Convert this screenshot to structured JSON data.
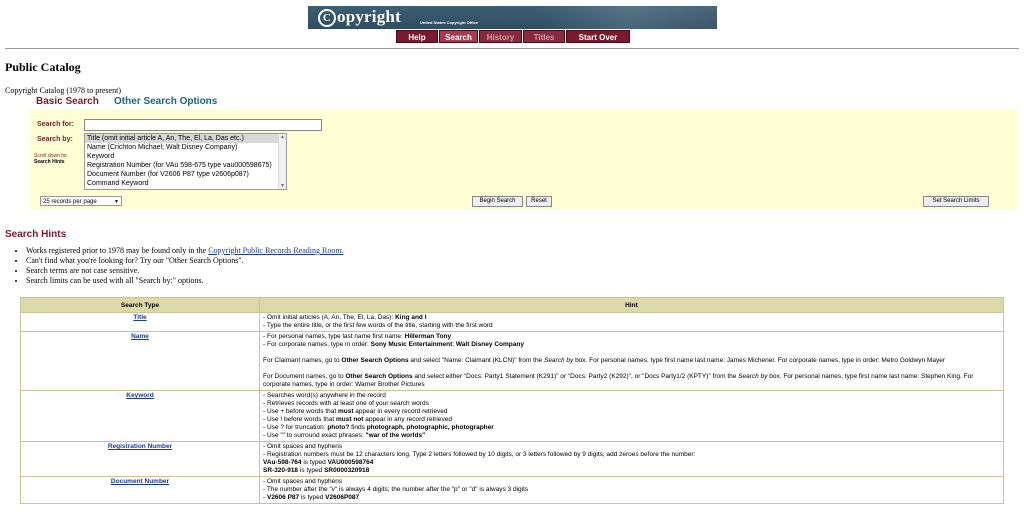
{
  "header": {
    "logo": "opyright",
    "logo_c": "C",
    "subtitle": "United States Copyright Office",
    "nav": [
      {
        "label": "Help",
        "state": "normal"
      },
      {
        "label": "Search",
        "state": "active"
      },
      {
        "label": "History",
        "state": "dim"
      },
      {
        "label": "Titles",
        "state": "dim"
      },
      {
        "label": "Start Over",
        "state": "normal"
      }
    ]
  },
  "page_title": "Public Catalog",
  "catalog_label": "Copyright Catalog (1978 to present)",
  "tabs": {
    "basic": "Basic Search",
    "other": "Other Search Options"
  },
  "search": {
    "search_for_label": "Search for:",
    "search_for_value": "",
    "search_by_label": "Search by:",
    "scroll_hint": "Scroll down for",
    "scroll_hint_bold": "Search Hints",
    "options": [
      "Title (omit initial article A, An, The, El, La, Das etc.)",
      "Name (Crichton Michael; Walt Disney Company)",
      "Keyword",
      "Registration Number (for VAu 598-675 type vau000598675)",
      "Document Number (for V2606 P87 type v2606p087)",
      "Command Keyword"
    ],
    "selected_index": 0
  },
  "controls": {
    "records_per_page": "25 records per page",
    "begin_search": "Begin Search",
    "reset": "Reset",
    "set_limits": "Set Search Limits"
  },
  "hints": {
    "heading": "Search Hints",
    "items": [
      {
        "pre": "Works registered prior to 1978 may be found only in the ",
        "link": "Copyright Public Records Reading Room.",
        "post": ""
      },
      {
        "pre": "Can't find what you're looking for? Try our \"Other Search Options\".",
        "link": "",
        "post": ""
      },
      {
        "pre": "Search terms are not case sensitive.",
        "link": "",
        "post": ""
      },
      {
        "pre": "Search limits can be used with all \"Search by:\" options.",
        "link": "",
        "post": ""
      }
    ]
  },
  "table": {
    "col_type": "Search Type",
    "col_hint": "Hint",
    "rows": [
      {
        "type": "Title",
        "lines": [
          "- Omit initial articles (A, An, The, El, La, Das): <b>King and I</b>",
          "- Type the entire title, or the first few words of the title, starting with the first word"
        ]
      },
      {
        "type": "Name",
        "lines": [
          "- For personal names, type last name first name: <b>Hillerman Tony</b>",
          "- For corporate names, type in order: <b>Sony Music Entertainment</b>; <b>Walt Disney Company</b>",
          "",
          "For Claimant names, go to <b>Other Search Options</b> and select \"Name: Claimant (KLCN)\" from the <i>Search by</i> box. For personal names, type first name last name: James Michener. For corporate names, type in order: Metro Goldwyn Mayer",
          "",
          "For Document names, go to <b>Other Search Options</b> and select either \"Docs: Party1 Statement (K291)\" or \"Docs: Party2 (K292)\", or \"Docs Party1/2 (KPTY)\" from the <i>Search by</i> box. For personal names, type first name last name: Stephen King. For corporate names, type in order: Warner Brother Pictures"
        ]
      },
      {
        "type": "Keyword",
        "lines": [
          "- Searches word(s) anywhere in the record",
          "- Retrieves records with at least one of your search words",
          "- Use + before words that <b>must</b> appear in every record retrieved",
          "- Use ! before words that <b>must not</b> appear in any record retrieved",
          "- Use ? for truncation: <b>photo?</b> finds <b>photograph, photographic, photographer</b>",
          "- Use \"\" to surround exact phrases: <b>\"war of the worlds\"</b>"
        ]
      },
      {
        "type": "Registration Number",
        "lines": [
          "- Omit spaces and hyphens",
          "- Registration numbers must be 12 characters long. Type 2 letters followed by 10 digits, or 3 letters followed by 9 digits; add zeroes before the number:",
          "<b>VAu-598-764</b> is typed <b>VAU000598764</b>",
          "<b>SR-320-918</b> is typed <b>SR0000320918</b>"
        ]
      },
      {
        "type": "Document Number",
        "lines": [
          "- Omit spaces and hyphens",
          "- The number after the \"v\" is always 4 digits; the number after the \"p\" or \"d\" is always 3 digits",
          "- <b>V2606 P87</b> is typed <b>V2606P087</b>"
        ]
      }
    ]
  }
}
